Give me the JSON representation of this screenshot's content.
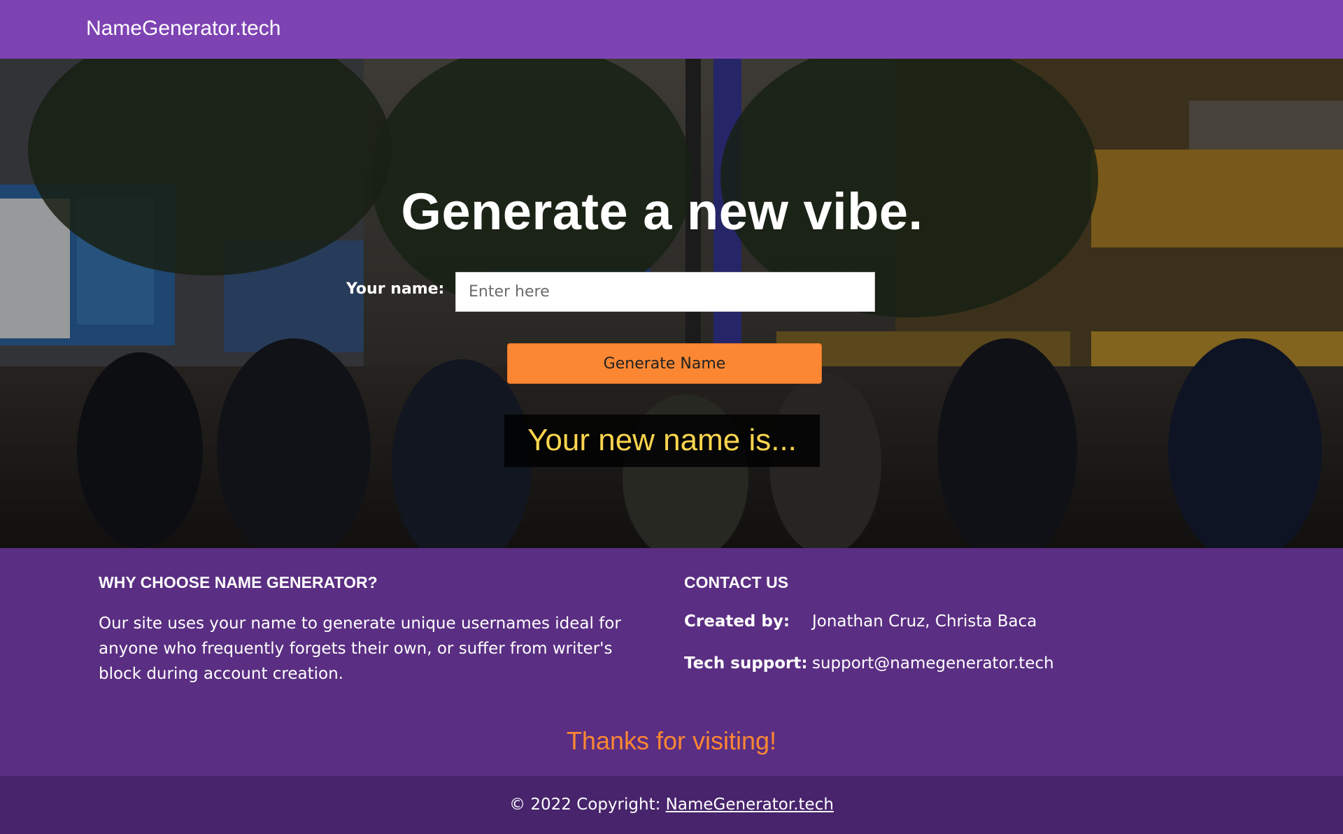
{
  "colors": {
    "navbar": "#7e43b3",
    "footer": "#5a2e82",
    "copyright_bar": "#48246c",
    "accent_orange": "#fb8733",
    "result_text": "#fbd54e"
  },
  "navbar": {
    "brand": "NameGenerator.tech"
  },
  "hero": {
    "background": "city-street-crowd-photo",
    "title": "Generate a new vibe.",
    "name_label": "Your name:",
    "name_input": {
      "value": "",
      "placeholder": "Enter here"
    },
    "generate_button": "Generate Name",
    "result_text": "Your new name is..."
  },
  "footer": {
    "why": {
      "heading": "WHY CHOOSE NAME GENERATOR?",
      "text": "Our site uses your name to generate unique usernames ideal for anyone who frequently forgets their own, or suffer from writer's block during account creation."
    },
    "contact": {
      "heading": "CONTACT US",
      "created_by_label": "Created by:",
      "created_by_value": "Jonathan Cruz, Christa Baca",
      "support_label": "Tech support:",
      "support_value": "support@namegenerator.tech"
    },
    "thanks": "Thanks for visiting!"
  },
  "copyright": {
    "prefix": "© 2022 Copyright: ",
    "link": "NameGenerator.tech"
  }
}
